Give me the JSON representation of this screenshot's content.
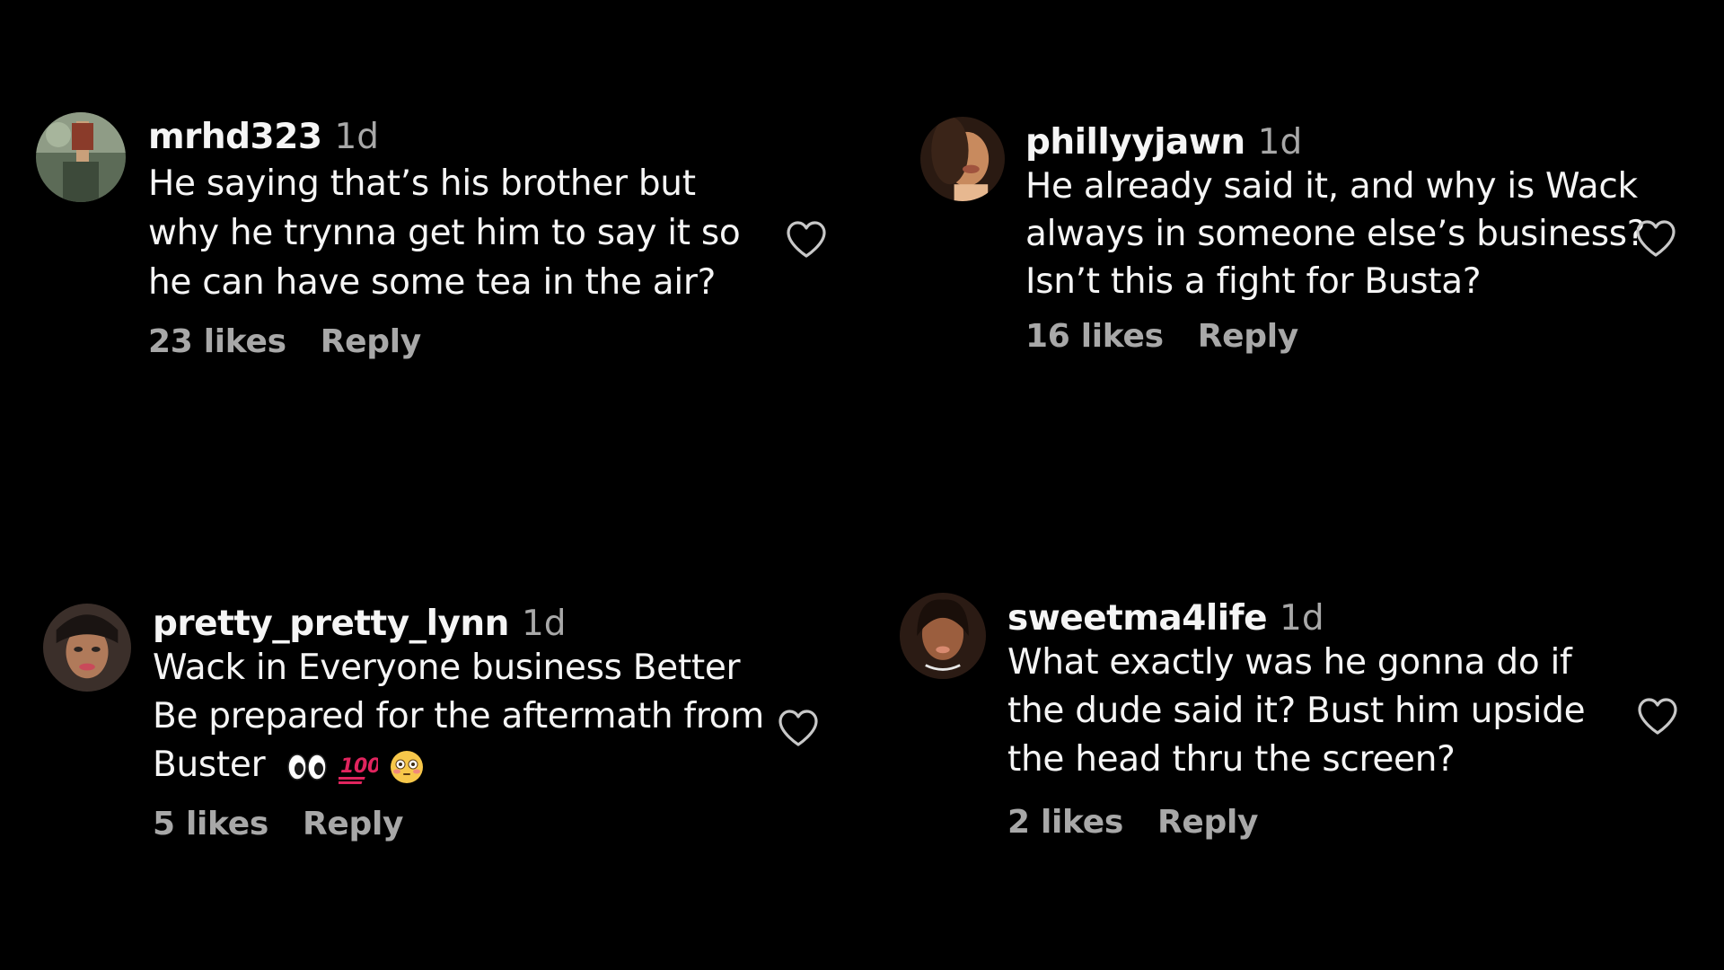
{
  "comments": [
    {
      "username": "mrhd323",
      "time": "1d",
      "lines": [
        "He saying that’s his brother but",
        "why he trynna get him to say it so",
        "he can have some tea in the air?"
      ],
      "likes": "23 likes",
      "reply": "Reply",
      "avatar_colors": [
        "#6f7f6a",
        "#c9a07a",
        "#8a3b2a"
      ],
      "heart_icon": "heart-outline-icon"
    },
    {
      "username": "phillyyjawn",
      "time": "1d",
      "lines": [
        "He already said it, and why is Wack",
        "always in someone else’s business?",
        "Isn’t this a fight for Busta?"
      ],
      "likes": "16 likes",
      "reply": "Reply",
      "avatar_colors": [
        "#3a2418",
        "#c88a5e",
        "#e7b890"
      ],
      "heart_icon": "heart-outline-icon"
    },
    {
      "username": "pretty_pretty_lynn",
      "time": "1d",
      "lines": [
        "Wack in Everyone business Better",
        "Be prepared for the aftermath from",
        "Buster"
      ],
      "emojis": [
        "eyes-emoji",
        "hundred-points-emoji",
        "flushed-face-emoji"
      ],
      "likes": "5 likes",
      "reply": "Reply",
      "avatar_colors": [
        "#2a2320",
        "#b07a5a",
        "#c94a5a"
      ],
      "heart_icon": "heart-outline-icon"
    },
    {
      "username": "sweetma4life",
      "time": "1d",
      "lines": [
        "What exactly was he gonna do if",
        "the dude said it? Bust him upside",
        "the head thru the screen?"
      ],
      "likes": "2 likes",
      "reply": "Reply",
      "avatar_colors": [
        "#2b1b14",
        "#9b5e3e",
        "#d98a70"
      ],
      "heart_icon": "heart-outline-icon"
    }
  ]
}
